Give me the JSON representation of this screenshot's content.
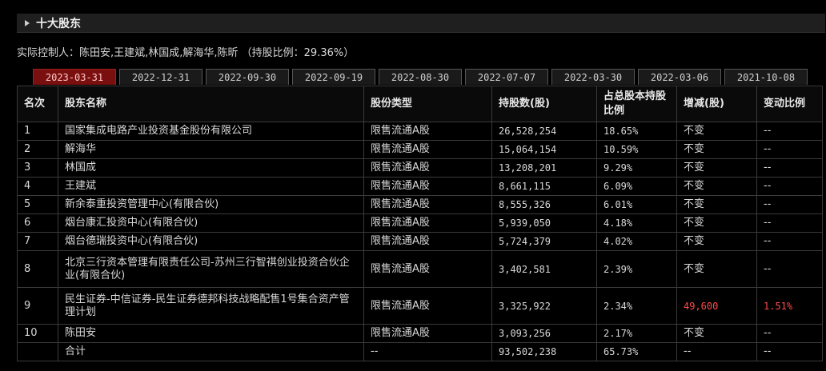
{
  "section": {
    "title": "十大股东"
  },
  "controller_text": "实际控制人：陈田安,王建斌,林国成,解海华,陈昕 （持股比例：29.36%）",
  "tabs": [
    "2023-03-31",
    "2022-12-31",
    "2022-09-30",
    "2022-09-19",
    "2022-08-30",
    "2022-07-07",
    "2022-03-30",
    "2022-03-06",
    "2021-10-08"
  ],
  "active_tab": "2023-03-31",
  "table": {
    "headers": [
      "名次",
      "股东名称",
      "股份类型",
      "持股数(股)",
      "占总股本持股比例",
      "增减(股)",
      "变动比例"
    ],
    "rows": [
      [
        "1",
        "国家集成电路产业投资基金股份有限公司",
        "限售流通A股",
        "26,528,254",
        "18.65%",
        "不变",
        "--"
      ],
      [
        "2",
        "解海华",
        "限售流通A股",
        "15,064,154",
        "10.59%",
        "不变",
        "--"
      ],
      [
        "3",
        "林国成",
        "限售流通A股",
        "13,208,201",
        "9.29%",
        "不变",
        "--"
      ],
      [
        "4",
        "王建斌",
        "限售流通A股",
        "8,661,115",
        "6.09%",
        "不变",
        "--"
      ],
      [
        "5",
        "新余泰重投资管理中心(有限合伙)",
        "限售流通A股",
        "8,555,326",
        "6.01%",
        "不变",
        "--"
      ],
      [
        "6",
        "烟台康汇投资中心(有限合伙)",
        "限售流通A股",
        "5,939,050",
        "4.18%",
        "不变",
        "--"
      ],
      [
        "7",
        "烟台德瑞投资中心(有限合伙)",
        "限售流通A股",
        "5,724,379",
        "4.02%",
        "不变",
        "--"
      ],
      [
        "8",
        "北京三行资本管理有限责任公司-苏州三行智祺创业投资合伙企业(有限合伙)",
        "限售流通A股",
        "3,402,581",
        "2.39%",
        "不变",
        "--"
      ],
      [
        "9",
        "民生证券-中信证券-民生证券德邦科技战略配售1号集合资产管理计划",
        "限售流通A股",
        "3,325,922",
        "2.34%",
        "49,600",
        "1.51%"
      ],
      [
        "10",
        "陈田安",
        "限售流通A股",
        "3,093,256",
        "2.17%",
        "不变",
        "--"
      ],
      [
        "",
        "合计",
        "--",
        "93,502,238",
        "65.73%",
        "--",
        "--"
      ]
    ]
  },
  "colors": {
    "active_tab_bg": "#7a0f0f",
    "increase_text": "#ff4a4a"
  },
  "icons": {
    "section_marker": "triangle-right-icon"
  }
}
